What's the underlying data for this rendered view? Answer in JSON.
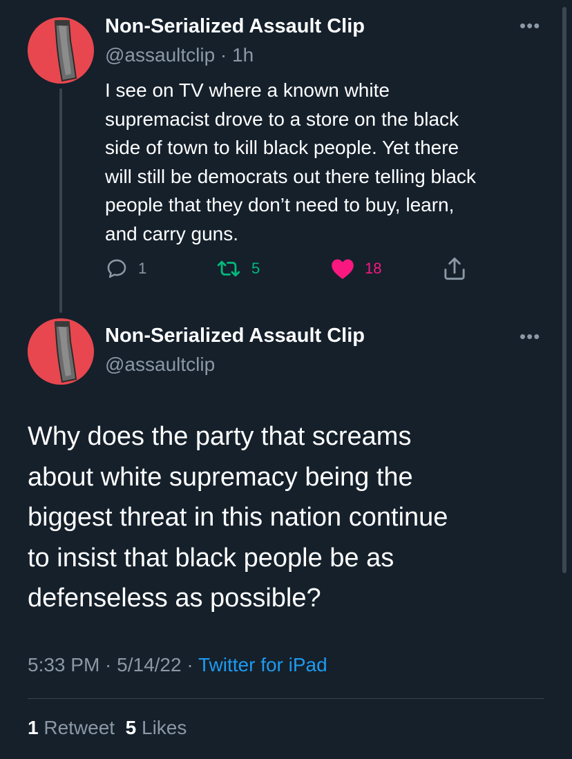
{
  "reply_tweet": {
    "display_name": "Non-Serialized Assault Clip",
    "handle": "@assaultclip",
    "time": "1h",
    "text_lines": [
      "I see on TV where a known white",
      "supremacist drove to a store on the black",
      "side of town to kill black people. Yet there",
      "will still be democrats out there telling black",
      "people that they don’t need to buy, learn,",
      "and carry guns."
    ],
    "reply_count": "1",
    "retweet_count": "5",
    "like_count": "18",
    "more_icon": "more-horizontal-icon",
    "avatar_icon": "magazine-clip-icon",
    "colors": {
      "like": "#f91880",
      "retweet": "#00ba7c",
      "link": "#1d9bf0"
    }
  },
  "main_tweet": {
    "display_name": "Non-Serialized Assault Clip",
    "handle": "@assaultclip",
    "text_lines": [
      "Why does the party that screams",
      "about white supremacy being the",
      "biggest threat in this nation continue",
      "to insist that black people be as",
      "defenseless as possible?"
    ],
    "timestamp": "5:33 PM · 5/14/22 · ",
    "source": "Twitter for iPad",
    "retweets_count": "1",
    "retweets_label": "Retweet",
    "likes_count": "5",
    "likes_label": "Likes"
  }
}
